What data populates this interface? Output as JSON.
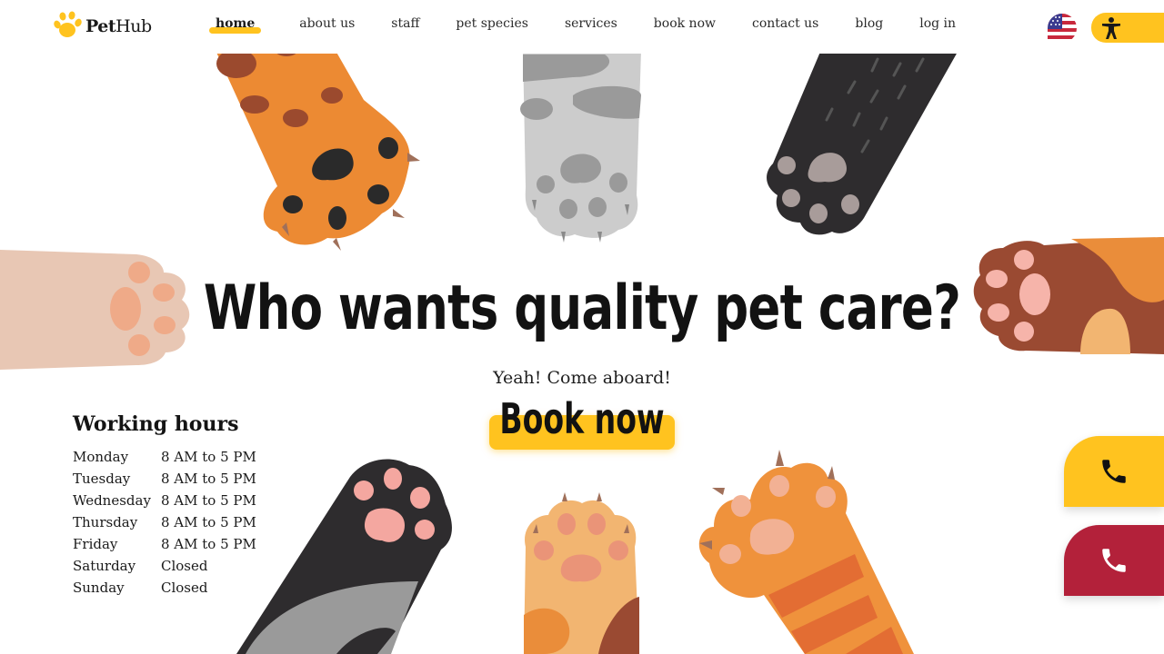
{
  "brand": {
    "name_bold": "Pet",
    "name_regular": "Hub",
    "logo_icon": "paw-icon",
    "color": "#ffc31f"
  },
  "nav": {
    "items": [
      {
        "label": "home",
        "active": true
      },
      {
        "label": "about us"
      },
      {
        "label": "staff"
      },
      {
        "label": "pet species"
      },
      {
        "label": "services"
      },
      {
        "label": "book now"
      },
      {
        "label": "contact us"
      },
      {
        "label": "blog"
      },
      {
        "label": "log in"
      }
    ]
  },
  "header_controls": {
    "language_icon": "us-flag-icon",
    "accessibility_icon": "accessibility-icon"
  },
  "hero": {
    "title": "Who wants quality pet care?",
    "subtitle": "Yeah! Come aboard!",
    "cta_label": "Book now"
  },
  "working_hours": {
    "title": "Working hours",
    "rows": [
      {
        "day": "Monday",
        "time": "8 AM to 5 PM"
      },
      {
        "day": "Tuesday",
        "time": "8 AM to 5 PM"
      },
      {
        "day": "Wednesday",
        "time": "8 AM to 5 PM"
      },
      {
        "day": "Thursday",
        "time": "8 AM to 5 PM"
      },
      {
        "day": "Friday",
        "time": "8 AM to 5 PM"
      },
      {
        "day": "Saturday",
        "time": "Closed"
      },
      {
        "day": "Sunday",
        "time": "Closed"
      }
    ]
  },
  "call_buttons": {
    "primary_icon": "phone-icon",
    "emergency_icon": "phone-icon"
  },
  "colors": {
    "accent": "#ffc31f",
    "emergency": "#b3213a",
    "text": "#121212"
  }
}
